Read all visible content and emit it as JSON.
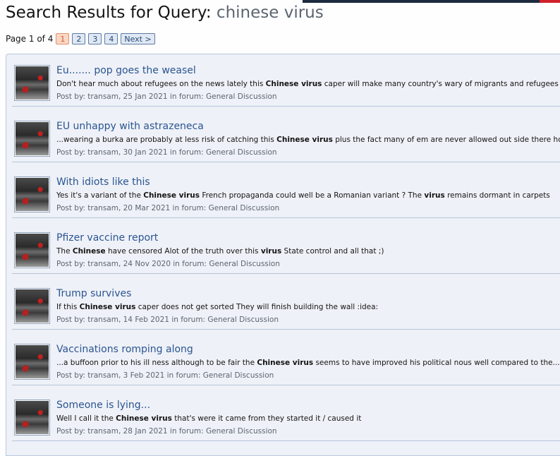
{
  "header": {
    "title_prefix": "Search Results for Query: ",
    "query": "chinese virus"
  },
  "pagination": {
    "label": "Page 1 of 4",
    "pages": [
      "1",
      "2",
      "3",
      "4"
    ],
    "current": "1",
    "next_label": "Next >"
  },
  "results": [
    {
      "title": "Eu....... pop goes the weasel",
      "snippet_parts": [
        {
          "t": "Don't hear much about refugees on the news lately this ",
          "b": false
        },
        {
          "t": "Chinese virus",
          "b": true
        },
        {
          "t": " caper will make many country's wary of migrants and refugees dare say...",
          "b": false
        }
      ],
      "meta": "Post by: transam, 25 Jan 2021 in forum: General Discussion"
    },
    {
      "title": "EU unhappy with astrazeneca",
      "snippet_parts": [
        {
          "t": "...wearing a burka are probably at less risk of catching this ",
          "b": false
        },
        {
          "t": "Chinese virus",
          "b": true
        },
        {
          "t": " plus the fact many of em are never allowed out side there home any...",
          "b": false
        }
      ],
      "meta": "Post by: transam, 30 Jan 2021 in forum: General Discussion"
    },
    {
      "title": "With idiots like this",
      "snippet_parts": [
        {
          "t": "Yes it's a variant of the ",
          "b": false
        },
        {
          "t": "Chinese virus",
          "b": true
        },
        {
          "t": " French propaganda could well be a Romanian variant ? The ",
          "b": false
        },
        {
          "t": "virus",
          "b": true
        },
        {
          "t": " remains dormant in carpets",
          "b": false
        }
      ],
      "meta": "Post by: transam, 20 Mar 2021 in forum: General Discussion"
    },
    {
      "title": "Pfizer vaccine report",
      "snippet_parts": [
        {
          "t": "The ",
          "b": false
        },
        {
          "t": "Chinese",
          "b": true
        },
        {
          "t": " have censored Alot of the truth over this ",
          "b": false
        },
        {
          "t": "virus",
          "b": true
        },
        {
          "t": " State control and all that ;)",
          "b": false
        }
      ],
      "meta": "Post by: transam, 24 Nov 2020 in forum: General Discussion"
    },
    {
      "title": "Trump survives",
      "snippet_parts": [
        {
          "t": "If this ",
          "b": false
        },
        {
          "t": "Chinese virus",
          "b": true
        },
        {
          "t": " caper does not get sorted They will finish building the wall :idea:",
          "b": false
        }
      ],
      "meta": "Post by: transam, 14 Feb 2021 in forum: General Discussion"
    },
    {
      "title": "Vaccinations romping along",
      "snippet_parts": [
        {
          "t": "...a buffoon prior to his ill ness although to be fair the ",
          "b": false
        },
        {
          "t": "Chinese virus",
          "b": true
        },
        {
          "t": " seems to have improved his political nous well compared to the...",
          "b": false
        }
      ],
      "meta": "Post by: transam, 3 Feb 2021 in forum: General Discussion"
    },
    {
      "title": "Someone is lying...",
      "snippet_parts": [
        {
          "t": "Well I call it the ",
          "b": false
        },
        {
          "t": "Chinese virus",
          "b": true
        },
        {
          "t": " that's were it came from they started it / caused it",
          "b": false
        }
      ],
      "meta": "Post by: transam, 28 Jan 2021 in forum: General Discussion"
    }
  ]
}
